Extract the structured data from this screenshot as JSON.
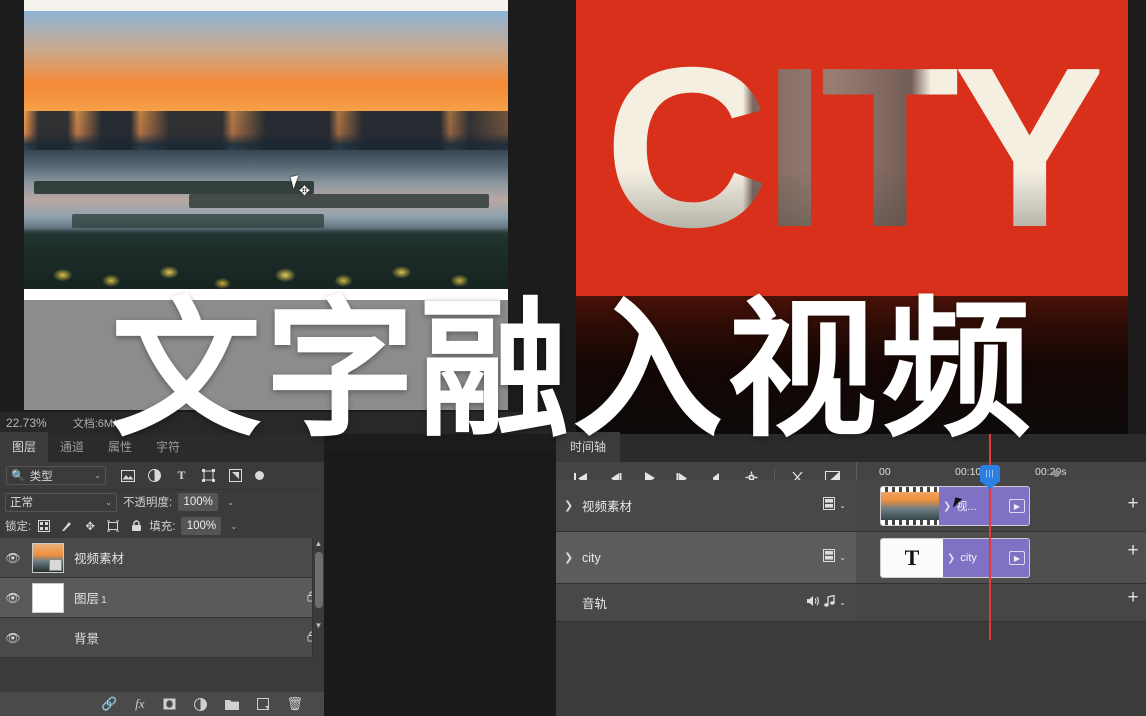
{
  "overlay": {
    "title": "文字融入视频"
  },
  "canvas": {
    "left_document": {
      "image_description": "sunset-city-waterfront-photo"
    },
    "right_preview": {
      "text": "CITY",
      "background_color": "#d8301a",
      "text_fill": "#f5efe2"
    }
  },
  "status_bar": {
    "zoom": "22.73%",
    "doc_info": "文档:6M/0.30M"
  },
  "layers_panel": {
    "tabs": [
      {
        "label": "图层",
        "active": true
      },
      {
        "label": "通道",
        "active": false
      },
      {
        "label": "属性",
        "active": false
      },
      {
        "label": "字符",
        "active": false
      }
    ],
    "filter": {
      "icon": "search-icon",
      "value": "类型",
      "chevron": "⌄",
      "type_icons": [
        "image-filter-icon",
        "adjustment-filter-icon",
        "text-filter-icon",
        "shape-filter-icon",
        "smart-object-filter-icon"
      ],
      "toggle": "filter-power-toggle"
    },
    "blend": {
      "mode": "正常",
      "opacity_label": "不透明度:",
      "opacity_value": "100%"
    },
    "lock": {
      "label": "锁定:",
      "icons": [
        "lock-transparent-icon",
        "lock-image-icon",
        "lock-position-icon",
        "lock-artboard-icon",
        "lock-all-icon"
      ],
      "fill_label": "填充:",
      "fill_value": "100%"
    },
    "layers": [
      {
        "name": "视频素材",
        "suffix": "",
        "visible": true,
        "locked": false,
        "thumb": "video",
        "selected": true
      },
      {
        "name": "图层",
        "suffix": "1",
        "visible": true,
        "locked": true,
        "thumb": "white",
        "selected": false
      },
      {
        "name": "背景",
        "suffix": "",
        "visible": true,
        "locked": true,
        "thumb": "empty",
        "selected": false
      }
    ],
    "bottom_icons": [
      "link-icon",
      "fx-icon",
      "layer-mask-icon",
      "adjustment-layer-icon",
      "new-group-icon",
      "new-layer-icon",
      "delete-layer-icon"
    ]
  },
  "timeline_panel": {
    "tabs": [
      {
        "label": "时间轴",
        "active": true
      }
    ],
    "toolbar_buttons": [
      "go-to-start-icon",
      "previous-frame-icon",
      "play-icon",
      "next-frame-icon",
      "audio-icon",
      "settings-gear-icon",
      "split-scissors-icon",
      "transition-icon"
    ],
    "ruler": {
      "marks": [
        "00",
        "00:10s",
        "00:20s"
      ]
    },
    "tracks": [
      {
        "name": "视频素材",
        "icon": "film-strip-icon",
        "selected": false,
        "clip": {
          "label": "视...",
          "type": "video",
          "thumb": "video-thumb"
        }
      },
      {
        "name": "city",
        "icon": "film-strip-icon",
        "selected": true,
        "clip": {
          "label": "city",
          "type": "text",
          "thumb": "T"
        }
      },
      {
        "name": "音轨",
        "icon": "speaker-icon",
        "icon2": "music-note-icon",
        "selected": false,
        "clip": null
      }
    ],
    "add_button": "+",
    "playhead_color": "#e23a3a",
    "playhead_handle_color": "#2b7fe0"
  }
}
